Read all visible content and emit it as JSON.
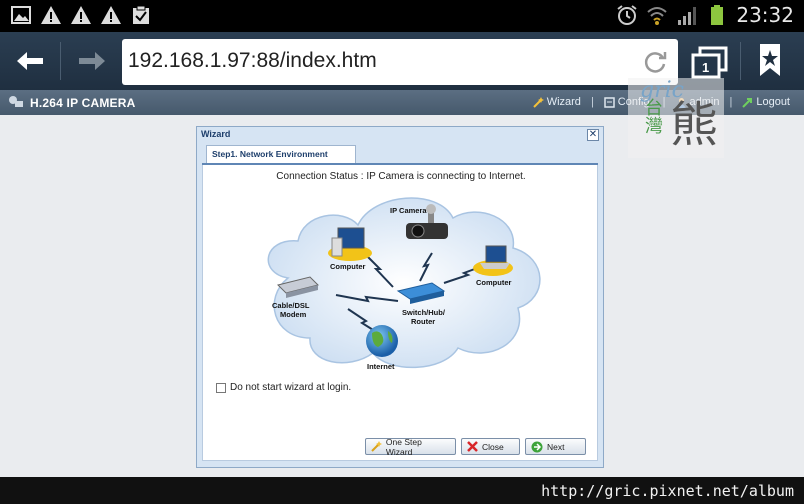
{
  "status_bar": {
    "time": "23:32",
    "left_icons": [
      "image-icon",
      "warning-icon",
      "warning-icon",
      "warning-icon",
      "clipboard-check-icon"
    ],
    "right_icons": [
      "alarm-icon",
      "wifi-icon",
      "signal-icon",
      "battery-icon"
    ]
  },
  "browser": {
    "url": "192.168.1.97:88/index.htm",
    "tab_count": "1"
  },
  "camera_header": {
    "title": "H.264 IP CAMERA",
    "menu": [
      {
        "label": "Wizard",
        "icon": "wand-icon"
      },
      {
        "label": "Config.",
        "icon": "config-icon"
      },
      {
        "label": "admin",
        "icon": "user-icon"
      },
      {
        "label": "Logout",
        "icon": "logout-icon"
      }
    ]
  },
  "wizard": {
    "title": "Wizard",
    "tab_label": "Step1. Network Environment",
    "connection_status": "Connection Status : IP Camera is connecting to Internet.",
    "diagram_labels": {
      "ip_camera": "IP Camera",
      "computer_left": "Computer",
      "computer_right": "Computer",
      "modem_line1": "Cable/DSL",
      "modem_line2": "Modem",
      "switch_line1": "Switch/Hub/",
      "switch_line2": "Router",
      "internet": "Internet"
    },
    "checkbox_label": "Do not start wizard at login.",
    "checkbox_checked": false,
    "buttons": {
      "one_step": "One Step Wizard",
      "close": "Close",
      "next": "Next"
    }
  },
  "watermark": {
    "latin": "gric",
    "cjk_small": "台灣",
    "cjk_big": "熊"
  },
  "footer": {
    "url": "http://gric.pixnet.net/album"
  }
}
